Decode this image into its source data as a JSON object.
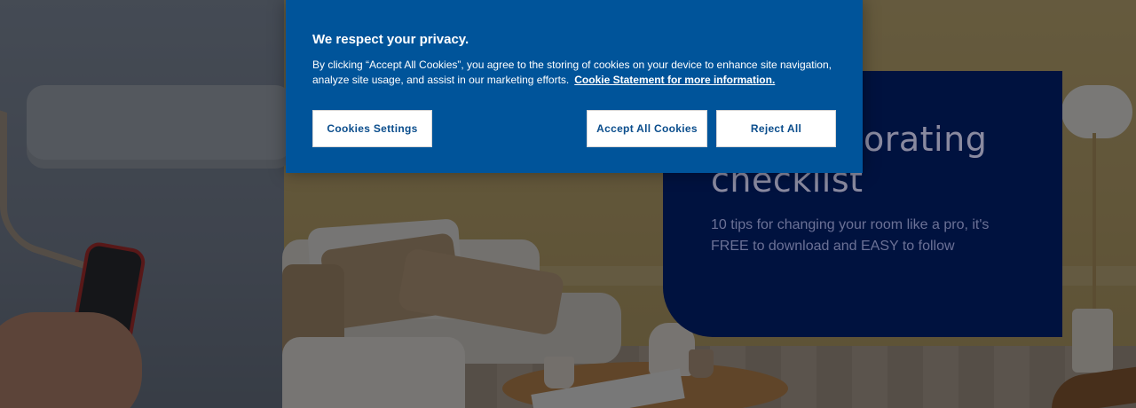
{
  "cookie_banner": {
    "title": "We respect your privacy.",
    "description": "By clicking “Accept All Cookies”, you agree to the storing of cookies on your device to enhance site navigation, analyze site usage, and assist in our marketing efforts.",
    "link_text": "Cookie Statement for more information.",
    "buttons": {
      "settings": "Cookies Settings",
      "accept": "Accept All Cookies",
      "reject": "Reject All"
    },
    "colors": {
      "background": "#00549a",
      "button_text": "#0a4d8c"
    }
  },
  "promo": {
    "title_line1": "orating",
    "title_line2": "checklist",
    "text": "10 tips for changing your room like a pro, it's FREE to download and EASY to follow",
    "colors": {
      "background": "#00123f"
    }
  },
  "hero": {
    "image_semantic": "living-room-paint-roller-photo",
    "overlay": "dimmed"
  }
}
